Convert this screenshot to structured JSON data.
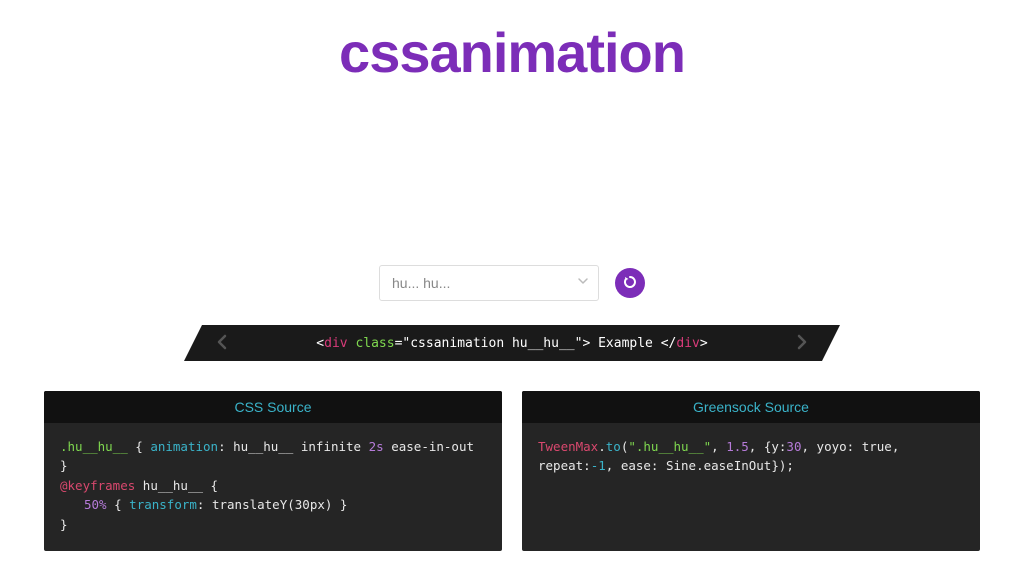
{
  "hero": {
    "title": "cssanimation"
  },
  "controls": {
    "select_value": "hu... hu...",
    "refresh_label": "Refresh"
  },
  "code_bar": {
    "open_tag": "div",
    "attr_name": "class",
    "attr_value": "cssanimation hu__hu__",
    "inner_text": " Example ",
    "close_tag": "div"
  },
  "panels": {
    "css": {
      "title": "CSS Source",
      "selector": ".hu__hu__",
      "prop_animation": "animation",
      "val_animation_name": "hu__hu__",
      "val_keyword_infinite": "infinite",
      "val_duration": "2s",
      "val_timing": "ease-in-out",
      "at_rule": "@keyframes",
      "keyframes_name": "hu__hu__",
      "stop_50": "50%",
      "prop_transform": "transform",
      "val_transform_fn": "translateY",
      "val_transform_arg": "30px"
    },
    "greensock": {
      "title": "Greensock Source",
      "cls": "TweenMax",
      "fn": "to",
      "selector_str": "\".hu__hu__\"",
      "dur": "1.5",
      "y_val": "30",
      "repeat_val": "-1",
      "rest_yoyo": "yoyo: true",
      "rest_repeat_label": "repeat:",
      "rest_ease": "ease: Sine.easeInOut"
    }
  }
}
